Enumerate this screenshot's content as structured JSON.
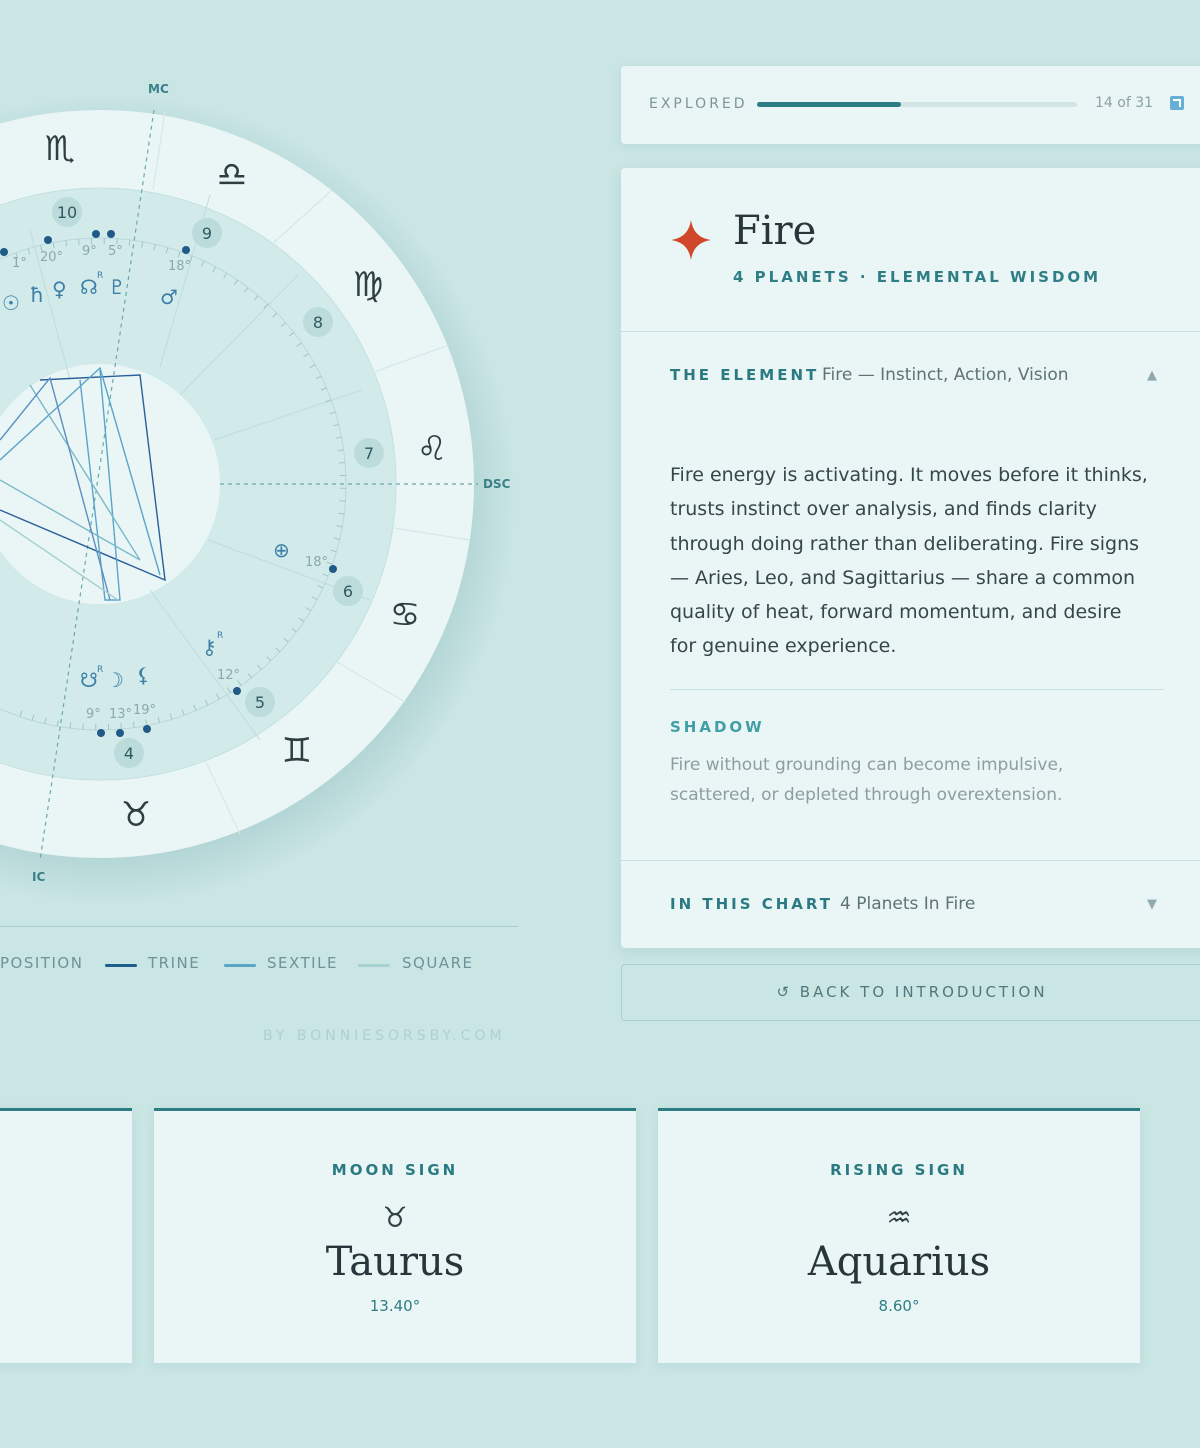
{
  "chart": {
    "angles": {
      "mc": "MC",
      "dsc": "DSC",
      "ic": "IC"
    },
    "houses": [
      "10",
      "9",
      "8",
      "7",
      "6",
      "5",
      "4"
    ],
    "signs": {
      "scorpio": "♏",
      "libra": "♎",
      "virgo": "♍",
      "leo": "♌",
      "cancer": "♋",
      "gemini": "♊",
      "taurus": "♉"
    },
    "degrees": [
      "1°",
      "20°",
      "9°",
      "5°",
      "18°",
      "18°",
      "12°",
      "9°",
      "13°",
      "19°"
    ],
    "planets": {
      "sun": "☉",
      "saturn": "ħ",
      "venus": "♀",
      "north_node": "☊",
      "pluto": "♇",
      "mars": "♂",
      "fortune": "⊕",
      "chiron": "⚷",
      "south_node": "☋",
      "moon": "☽",
      "lilith": "⚸",
      "retro": "R"
    },
    "colors": {
      "opposition": "#1f5e8c",
      "trine": "#2a5f9a",
      "sextile": "#5aa4c8",
      "square": "#a7d0d1"
    }
  },
  "legend": {
    "opposition": "POSITION",
    "trine": "TRINE",
    "sextile": "SEXTILE",
    "square": "SQUARE"
  },
  "credit": "BY BONNIESORSBY.COM",
  "explored": {
    "label": "EXPLORED",
    "count_text": "14 of 31",
    "progress": 0.45,
    "link_icon": "external-link-icon"
  },
  "element": {
    "icon": "four-point-star-icon",
    "accent": "#d1472b",
    "title": "Fire",
    "subtitle": "4 PLANETS · ELEMENTAL WISDOM",
    "section1": {
      "heading": "THE ELEMENT",
      "summary": "Fire — Instinct, Action, Vision",
      "caret": "▲"
    },
    "body_lines": [
      "Fire energy is activating. It moves before it thinks,",
      "trusts instinct over analysis, and finds clarity",
      "through doing rather than deliberating. Fire signs",
      "— Aries, Leo, and Sagittarius — share a common",
      "quality of heat, forward momentum, and desire",
      "for genuine experience."
    ],
    "shadow": {
      "heading": "SHADOW",
      "lines": [
        "Fire without grounding can become impulsive,",
        "scattered, or depleted through overextension."
      ]
    },
    "section2": {
      "heading": "IN THIS CHART",
      "summary": "4 Planets In Fire",
      "caret": "▼"
    }
  },
  "back_button": "↺ BACK TO INTRODUCTION",
  "sign_cards": {
    "moon": {
      "heading": "MOON SIGN",
      "glyph": "♉",
      "name": "Taurus",
      "degree": "13.40°"
    },
    "rising": {
      "heading": "RISING SIGN",
      "glyph": "♒",
      "name": "Aquarius",
      "degree": "8.60°"
    }
  }
}
